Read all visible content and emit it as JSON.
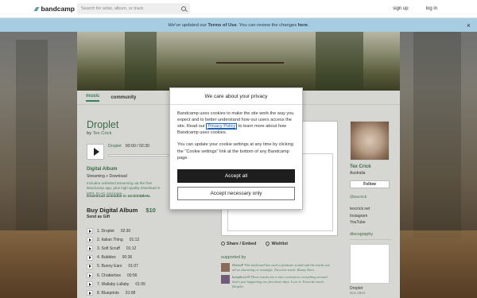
{
  "topbar": {
    "logo": "bandcamp",
    "search_placeholder": "Search for artist, album, or track",
    "sign_up": "sign up",
    "log_in": "log in"
  },
  "banner": {
    "prefix": "We've updated our ",
    "terms": "Terms of Use",
    "middle": ". You can review the changes ",
    "here": "here",
    "suffix": "."
  },
  "tabs": {
    "music": "music",
    "community": "community"
  },
  "album": {
    "title": "Droplet",
    "by": "by",
    "artist": "Tex Crick",
    "player_track": "Droplet",
    "player_time": "00:00 / 02:30",
    "progress": 0
  },
  "digital": {
    "title": "Digital Album",
    "subtitle": "Streaming + Download",
    "desc": "Includes unlimited streaming via the free Bandcamp app, plus high-quality download in MP3, FLAC and more.",
    "download_note": "Download available in 24-bit/48kHz.",
    "buy_label": "Buy Digital Album",
    "price": "$10",
    "gift": "Send as Gift"
  },
  "tracks": [
    {
      "label": "1. Droplet",
      "time": "02:30"
    },
    {
      "label": "2. Italian Thing",
      "time": "01:12"
    },
    {
      "label": "3. Soft Scruff",
      "time": "01:12"
    },
    {
      "label": "4. Bubbles",
      "time": "00:36"
    },
    {
      "label": "5. Bunny Ears",
      "time": "01:07"
    },
    {
      "label": "6. Chatterbox",
      "time": "00:56"
    },
    {
      "label": "7. Wallaby Lullaby",
      "time": "01:55"
    },
    {
      "label": "8. Blueprints",
      "time": "01:08"
    }
  ],
  "share": {
    "share_embed": "Share / Embed",
    "wishlist": "Wishlist"
  },
  "supported": {
    "label": "supported by",
    "items": [
      {
        "name": "DebraP",
        "text": "This keyboard has such a fantastic sound and the tracks are all as charming or nostalgic. Favorite track: Bunny Ears."
      },
      {
        "name": "humphrey19",
        "text": "These tracks are a nice contrast to everything around that's just happening too fast these days. Love it. Favorite track: Droplet."
      }
    ]
  },
  "sidebar": {
    "name": "Tex Crick",
    "location": "Australia",
    "follow": "Follow",
    "handle": "@texcrick",
    "links": [
      "texcrick.net",
      "Instagram",
      "YouTube"
    ],
    "discography": "discography",
    "disco_title": "Droplet",
    "disco_date": "Nov 2024"
  },
  "modal": {
    "title": "We care about your privacy",
    "p1_before": "Bandcamp uses cookies to make the site work the way you expect and to better understand how our users access the site. Read our ",
    "p1_link": "Privacy Policy",
    "p1_after": " to learn more about how Bandcamp uses cookies.",
    "p2": "You can update your cookie settings at any time by clicking the \"Cookie settings\" link at the bottom of any Bandcamp page.",
    "accept_all": "Accept all",
    "accept_necessary": "Accept necessary only"
  }
}
